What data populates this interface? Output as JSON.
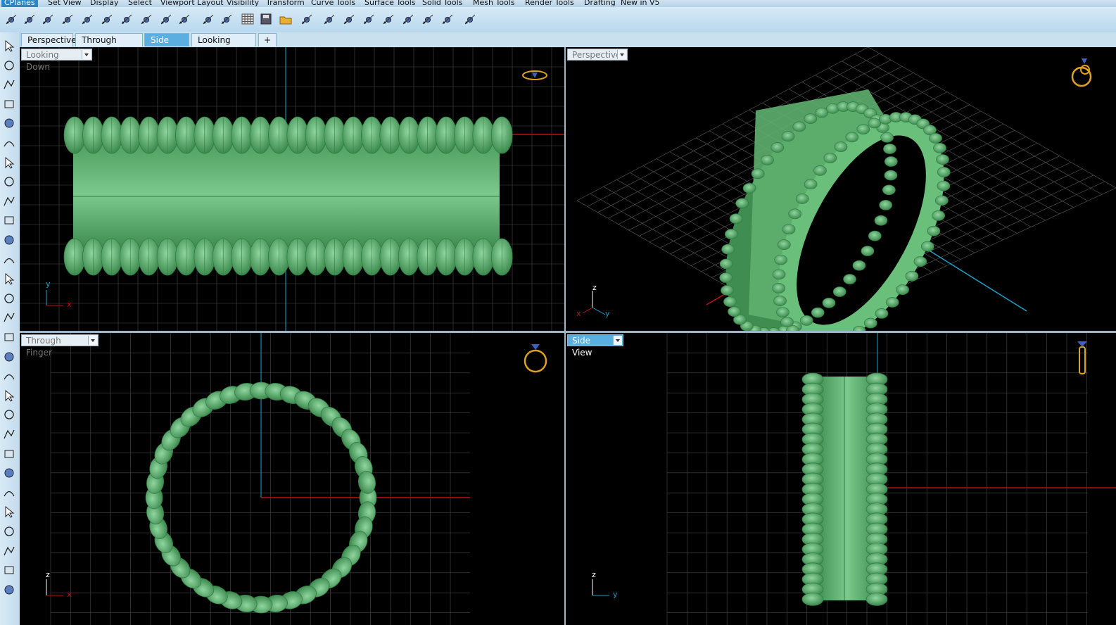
{
  "menu_tabs": [
    "CPlanes",
    "Set View",
    "Display",
    "Select",
    "Viewport Layout",
    "Visibility",
    "Transform",
    "Curve Tools",
    "Surface Tools",
    "Solid Tools",
    "Mesh Tools",
    "Render Tools",
    "Drafting",
    "New in V5"
  ],
  "view_tabs": {
    "items": [
      "Perspective",
      "Through Finger",
      "Side View",
      "Looking Down"
    ],
    "active": "Side View",
    "add_label": "+"
  },
  "viewports": {
    "top_left": {
      "label": "Looking Down",
      "axis_a": "y",
      "axis_b": "x"
    },
    "top_right": {
      "label": "Perspective",
      "axis_a": "z",
      "axis_b": "y",
      "axis_c": "x"
    },
    "bottom_left": {
      "label": "Through Finger",
      "axis_a": "z",
      "axis_b": "x"
    },
    "bottom_right": {
      "label": "Side View",
      "axis_a": "z",
      "axis_b": "y"
    }
  },
  "colors": {
    "model": "#5fbf75",
    "model_dark": "#2f7f45",
    "grid": "#6a6a6a",
    "x_axis": "#c01010",
    "y_axis": "#1f9fc8",
    "active_tab": "#5aaee0",
    "widget": "#e0a020"
  },
  "toolbar_icons": [
    "select-icon",
    "point-icon",
    "polyline-icon",
    "curve-icon",
    "circle-icon",
    "ellipse-icon",
    "arc-icon",
    "rectangle-icon",
    "polygon-icon",
    "fillet-icon",
    "surface-icon",
    "revolve-icon",
    "box-icon",
    "sphere-icon",
    "cylinder-icon",
    "extrude-icon",
    "gear-icon",
    "explode-icon",
    "trim-icon",
    "split-icon",
    "boolean-icon",
    "group-icon",
    "curve-edit-icon",
    "blend-icon",
    "text-icon",
    "transform-icon",
    "array-icon",
    "dimension-icon",
    "more-icon"
  ]
}
